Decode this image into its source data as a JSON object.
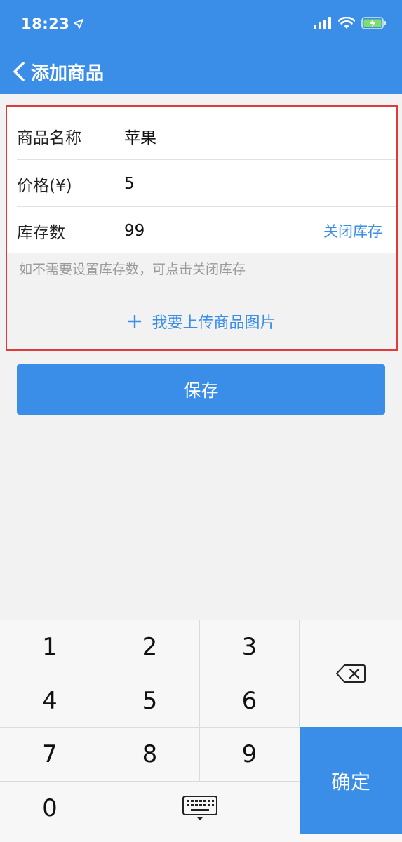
{
  "status_bar": {
    "time": "18:23"
  },
  "nav": {
    "title": "添加商品"
  },
  "form": {
    "rows": [
      {
        "label": "商品名称",
        "value": "苹果"
      },
      {
        "label": "价格(¥)",
        "value": "5"
      },
      {
        "label": "库存数",
        "value": "99"
      }
    ],
    "close_stock_label": "关闭库存",
    "hint": "如不需要设置库存数，可点击关闭库存",
    "upload_label": "我要上传商品图片"
  },
  "save_button": {
    "label": "保存"
  },
  "keypad": {
    "keys": [
      "1",
      "2",
      "3",
      "4",
      "5",
      "6",
      "7",
      "8",
      "9",
      "0"
    ],
    "confirm_label": "确定"
  },
  "colors": {
    "primary": "#3a8ee8",
    "highlight_border": "#e03b3b",
    "background": "#f2f2f2",
    "hint_text": "#9a9a9a"
  }
}
